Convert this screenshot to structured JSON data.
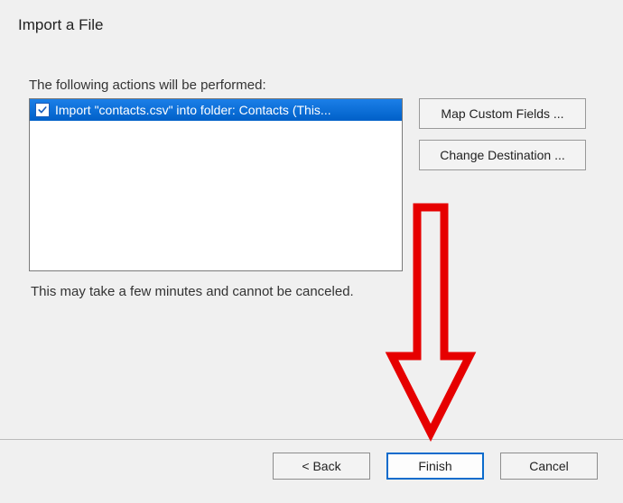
{
  "dialog": {
    "title": "Import a File",
    "instructions": "The following actions will be performed:",
    "items": [
      {
        "checked": true,
        "label": "Import \"contacts.csv\" into folder: Contacts (This..."
      }
    ],
    "side_buttons": {
      "map_fields": "Map Custom Fields ...",
      "change_destination": "Change Destination ..."
    },
    "warning": "This may take a few minutes and cannot be canceled.",
    "footer": {
      "back": "< Back",
      "finish": "Finish",
      "cancel": "Cancel"
    }
  },
  "annotation": {
    "arrow_color": "#e60000",
    "arrow_target": "finish-button"
  }
}
